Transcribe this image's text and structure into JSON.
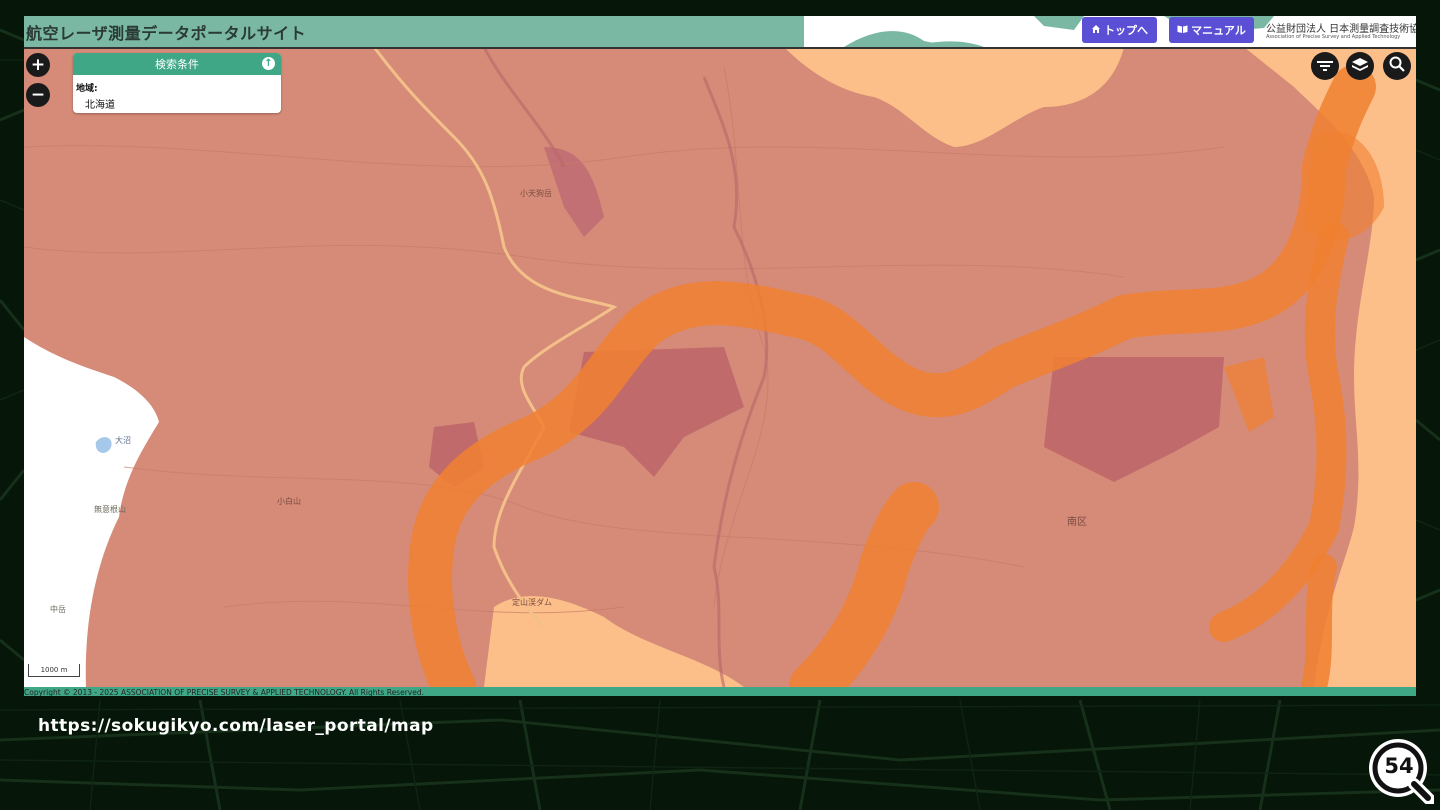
{
  "header": {
    "site_title": "航空レーザ測量データポータルサイト",
    "top_button": "トップへ",
    "manual_button": "マニュアル",
    "org_name_jp": "公益財団法人 日本測量調査技術協",
    "org_name_en": "Association of Precise Survey and Applied Technology"
  },
  "search_panel": {
    "title": "検索条件",
    "region_label": "地域:",
    "region_value": "北海道"
  },
  "map": {
    "place_labels": [
      "南区",
      "小白山",
      "大沼",
      "無意根山",
      "定山渓ダム",
      "小天狗岳",
      "中岳"
    ],
    "scale_label": "1000 m",
    "copyright": "Copyright © 2013 - 2025 ASSOCIATION OF PRECISE SURVEY & APPLIED TECHNOLOGY. All Rights Reserved.",
    "colors": {
      "base_overlay": "#d58b77",
      "orange_band": "#f08030",
      "light_orange": "#fdbf8a",
      "dark_patch": "#c06a6c"
    }
  },
  "footer": {
    "url": "https://sokugikyo.com/laser_portal/map",
    "page_number": "54"
  }
}
